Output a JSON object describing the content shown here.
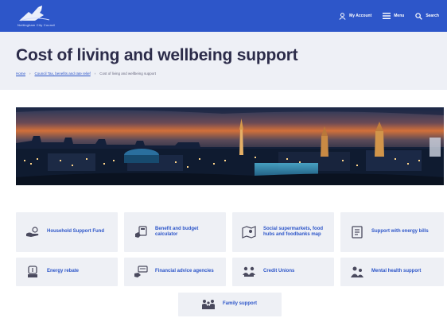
{
  "header": {
    "logo_text": "Nottingham City Council",
    "nav": {
      "account": "My Account",
      "menu": "Menu",
      "search": "Search"
    }
  },
  "page": {
    "title": "Cost of living and wellbeing support",
    "breadcrumb": [
      "Home",
      "Council Tax, benefits and rate relief",
      "Cost of living and wellbeing support"
    ]
  },
  "hero": {
    "alt": "Nottingham city skyline at night"
  },
  "cards": [
    {
      "label": "Household Support Fund",
      "icon": "hands-coins-icon"
    },
    {
      "label": "Benefit and budget calculator",
      "icon": "calculator-hand-icon"
    },
    {
      "label": "Social supermarkets, food hubs and foodbanks map",
      "icon": "map-icon"
    },
    {
      "label": "Support with energy bills",
      "icon": "bill-icon"
    },
    {
      "label": "Energy rebate",
      "icon": "energy-icon"
    },
    {
      "label": "Financial advice agencies",
      "icon": "advice-icon"
    },
    {
      "label": "Credit Unions",
      "icon": "people-icon"
    },
    {
      "label": "Mental health support",
      "icon": "mental-health-icon"
    },
    {
      "label": "Family support",
      "icon": "family-icon"
    }
  ],
  "colors": {
    "brand": "#2d56c9",
    "card_bg": "#eef0f5",
    "title_band": "#eef0f6"
  }
}
